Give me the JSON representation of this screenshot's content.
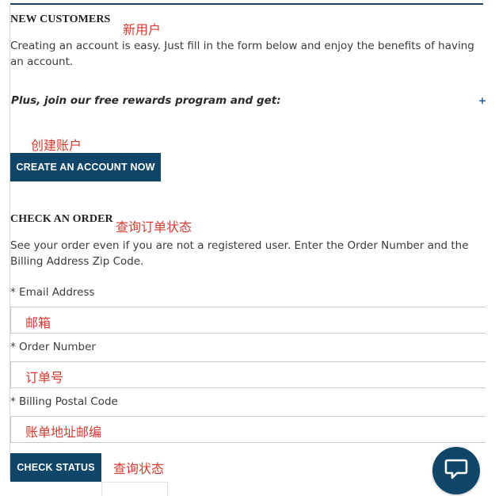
{
  "new_customers": {
    "heading": "NEW CUSTOMERS",
    "note": "新用户",
    "description": "Creating an account is easy. Just fill in the form below and enjoy the benefits of having an account.",
    "promo": "Plus, join our free rewards program and get:",
    "expand_symbol": "+",
    "button_note": "创建账户",
    "create_button": "CREATE AN ACCOUNT NOW"
  },
  "check_order": {
    "heading": "CHECK AN ORDER",
    "note": "查询订单状态",
    "description": "See your order even if you are not a registered user. Enter the Order Number and the Billing Address Zip Code.",
    "email": {
      "label": "* Email Address",
      "hint": "邮箱"
    },
    "order_number": {
      "label": "* Order Number",
      "hint": "订单号"
    },
    "billing_postal": {
      "label": "* Billing Postal Code",
      "hint": "账单地址邮编"
    },
    "check_button": "CHECK STATUS",
    "button_note": "查询状态"
  },
  "chat": {
    "icon": "chat-bubble-icon"
  },
  "colors": {
    "primary": "#0f4568",
    "annotation": "#d93a2f",
    "topline": "#1a4266"
  }
}
